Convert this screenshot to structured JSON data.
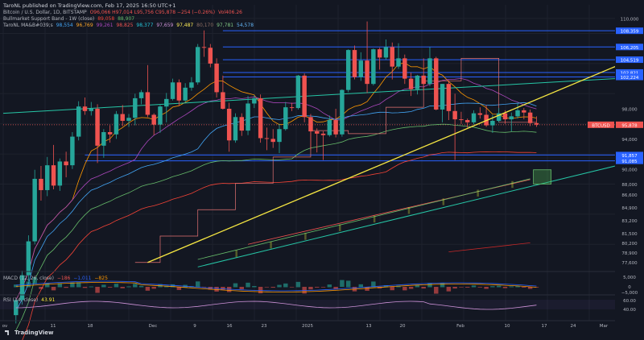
{
  "publisher": "TaroNL published on TradingView.com, Feb 17, 2025 16:50 UTC+1",
  "brand": "TradingView",
  "legend": {
    "symbol": "Bitcoin / U.S. Dollar, 1D, BITSTAMP",
    "ohlc": "O96,066 H97,014 L95,756 C95,878 −254 (−0.26%)",
    "vol": "Vol406.26",
    "bmsb_name": "Bullmarket Support Band - 1W (close)",
    "bmsb_values": [
      "89,058",
      "88,907"
    ],
    "ma_name": "TaroNL MA&B#039;s",
    "ma_values": [
      "98,554",
      "96,769",
      "99,261",
      "98,825",
      "98,377",
      "97,659",
      "97,487",
      "80,170",
      "97,781",
      "54,578"
    ],
    "macd_label": "MACD (12, 26, close)",
    "macd_values": [
      "−186",
      "−1,011",
      "−825"
    ],
    "rsi_label": "RSI (14, close)",
    "rsi_value": "43.91"
  },
  "colors": {
    "background": "#131722",
    "up": "#26a69a",
    "down": "#ef5350",
    "level_line": "#2962ff",
    "trendline": "#f5e642",
    "channel": "#26c6a6"
  },
  "chart_data": {
    "type": "candlestick",
    "symbol": "BTCUSD",
    "timeframe": "1D",
    "ylim": [
      76500,
      111800
    ],
    "price_ticks": [
      "110,000",
      "108,359",
      "106,205",
      "104,519",
      "102,821",
      "102,224",
      "98,000",
      "95,878",
      "94,000",
      "91,857",
      "91,085",
      "90,000",
      "88,000",
      "86,600",
      "84,900",
      "83,200",
      "81,500",
      "80,200",
      "78,900",
      "77,600"
    ],
    "x_ticks": [
      "ov",
      "11",
      "18",
      "Dec",
      "9",
      "16",
      "23",
      "2025",
      "13",
      "20",
      "Feb",
      "10",
      "17",
      "24",
      "Mar"
    ],
    "current_price": {
      "label": "BTCUSD",
      "value": 95878,
      "text": "95,878"
    },
    "levels": [
      {
        "value": 108359,
        "text": "108,359"
      },
      {
        "value": 106205,
        "text": "106,205"
      },
      {
        "value": 104519,
        "text": "104,519"
      },
      {
        "value": 102821,
        "text": "102,821"
      },
      {
        "value": 102224,
        "text": "102,224"
      },
      {
        "value": 91857,
        "text": "91,857"
      },
      {
        "value": 91085,
        "text": "91,085"
      }
    ],
    "candles": [
      [
        1,
        70600,
        72800,
        69500,
        72600
      ],
      [
        2,
        72600,
        76500,
        72000,
        75900
      ],
      [
        3,
        75900,
        81200,
        75100,
        80400
      ],
      [
        4,
        80400,
        89900,
        80000,
        88700
      ],
      [
        5,
        88700,
        90400,
        85800,
        87200
      ],
      [
        6,
        87200,
        91600,
        86400,
        90500
      ],
      [
        7,
        90500,
        93200,
        87300,
        87800
      ],
      [
        8,
        87800,
        91400,
        87100,
        91000
      ],
      [
        9,
        91000,
        92300,
        88900,
        90500
      ],
      [
        10,
        90500,
        94900,
        90000,
        94300
      ],
      [
        11,
        94300,
        99000,
        93800,
        98300
      ],
      [
        12,
        98300,
        99500,
        97200,
        97700
      ],
      [
        13,
        97700,
        98900,
        97100,
        98000
      ],
      [
        14,
        98000,
        98600,
        90800,
        93100
      ],
      [
        15,
        93100,
        95300,
        91500,
        94900
      ],
      [
        16,
        94900,
        95800,
        93500,
        94600
      ],
      [
        17,
        94600,
        97700,
        94000,
        97300
      ],
      [
        18,
        97300,
        98500,
        95700,
        96400
      ],
      [
        19,
        96400,
        97300,
        95600,
        96800
      ],
      [
        20,
        96800,
        100000,
        95800,
        99400
      ],
      [
        21,
        99400,
        100500,
        98600,
        100200
      ],
      [
        22,
        100200,
        103800,
        96900,
        97200
      ],
      [
        23,
        97200,
        97400,
        94500,
        95900
      ],
      [
        24,
        95900,
        98500,
        94800,
        98300
      ],
      [
        25,
        98300,
        100100,
        96200,
        99300
      ],
      [
        26,
        99300,
        102000,
        99100,
        101500
      ],
      [
        27,
        101500,
        101900,
        98400,
        99100
      ],
      [
        28,
        99100,
        101400,
        98900,
        100800
      ],
      [
        29,
        100800,
        102200,
        100400,
        101500
      ],
      [
        30,
        101500,
        106600,
        101200,
        106200
      ],
      [
        31,
        106200,
        108400,
        104900,
        106100
      ],
      [
        32,
        106100,
        106600,
        103500,
        104000
      ],
      [
        33,
        104000,
        104700,
        99500,
        100200
      ],
      [
        34,
        100200,
        102400,
        97900,
        98000
      ],
      [
        35,
        98000,
        98800,
        92300,
        93800
      ],
      [
        36,
        93800,
        97400,
        93500,
        96900
      ],
      [
        37,
        96900,
        97400,
        94400,
        95100
      ],
      [
        38,
        95100,
        99700,
        94500,
        98700
      ],
      [
        39,
        98700,
        99800,
        98100,
        99400
      ],
      [
        40,
        99400,
        99900,
        93500,
        94100
      ],
      [
        41,
        94100,
        95500,
        92500,
        94000
      ],
      [
        42,
        94000,
        95300,
        92800,
        93600
      ],
      [
        43,
        93600,
        96000,
        92100,
        95300
      ],
      [
        44,
        95300,
        98900,
        95100,
        98200
      ],
      [
        45,
        98200,
        98800,
        97700,
        98100
      ],
      [
        46,
        98100,
        102500,
        97900,
        102400
      ],
      [
        47,
        102400,
        102700,
        96200,
        96900
      ],
      [
        48,
        96900,
        97300,
        92500,
        95000
      ],
      [
        49,
        95000,
        95400,
        92200,
        94700
      ],
      [
        50,
        94700,
        95000,
        91200,
        94500
      ],
      [
        51,
        94500,
        97100,
        94300,
        96500
      ],
      [
        52,
        96500,
        98000,
        94200,
        94600
      ],
      [
        53,
        94600,
        100600,
        94300,
        100500
      ],
      [
        54,
        100500,
        105900,
        100200,
        105800
      ],
      [
        55,
        105800,
        106400,
        101900,
        102200
      ],
      [
        56,
        102200,
        105500,
        101700,
        104400
      ],
      [
        57,
        104400,
        109600,
        100100,
        101300
      ],
      [
        58,
        101300,
        106000,
        101100,
        105900
      ],
      [
        59,
        105900,
        106100,
        103200,
        104800
      ],
      [
        60,
        104800,
        107200,
        104500,
        106200
      ],
      [
        61,
        106200,
        106800,
        101900,
        103600
      ],
      [
        62,
        103600,
        106700,
        103300,
        104700
      ],
      [
        63,
        104700,
        105200,
        101300,
        102000
      ],
      [
        64,
        102000,
        102800,
        99700,
        100600
      ],
      [
        65,
        100600,
        102500,
        99900,
        102400
      ],
      [
        66,
        102400,
        104700,
        100300,
        101300
      ],
      [
        67,
        101300,
        106200,
        101000,
        104700
      ],
      [
        68,
        104700,
        104900,
        97800,
        97900
      ],
      [
        69,
        97900,
        101300,
        96200,
        101300
      ],
      [
        70,
        101300,
        101800,
        96500,
        97700
      ],
      [
        71,
        97700,
        100000,
        91200,
        96600
      ],
      [
        72,
        96600,
        97600,
        96000,
        96500
      ],
      [
        73,
        96500,
        96700,
        95500,
        96200
      ],
      [
        74,
        96200,
        97800,
        95900,
        97400
      ],
      [
        75,
        97400,
        98200,
        96700,
        97200
      ],
      [
        76,
        97200,
        98500,
        95600,
        95800
      ],
      [
        77,
        95800,
        97200,
        94800,
        96400
      ],
      [
        78,
        96400,
        98100,
        96200,
        97400
      ],
      [
        79,
        97400,
        97800,
        96000,
        96600
      ],
      [
        80,
        96600,
        97500,
        95000,
        97000
      ],
      [
        81,
        97000,
        98800,
        96700,
        97800
      ],
      [
        82,
        97800,
        98100,
        96600,
        97500
      ],
      [
        83,
        97500,
        97900,
        95700,
        96100
      ],
      [
        84,
        96100,
        97000,
        95600,
        95900
      ]
    ],
    "series": [
      {
        "name": "Bullmarket Support Band - 1W (close)",
        "values": [
          89058,
          88907
        ]
      }
    ],
    "subpanes": [
      {
        "name": "MACD (12, 26, close)",
        "ticks": [
          "5,000",
          "0",
          "−5,000"
        ],
        "values": [
          -186,
          -1011,
          -825
        ]
      },
      {
        "name": "RSI (14, close)",
        "ticks": [
          "60.00",
          "40.00"
        ],
        "value": 43.91
      }
    ]
  }
}
